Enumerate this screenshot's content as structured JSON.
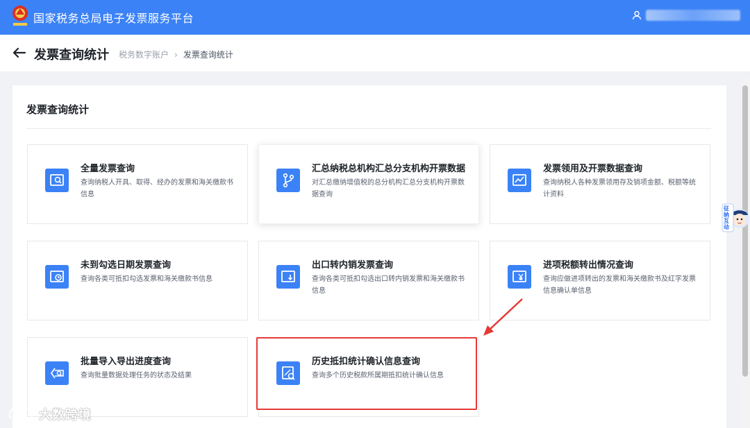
{
  "header": {
    "app_title": "国家税务总局电子发票服务平台",
    "logo_text": "国家税务",
    "brand_color": "#3b82f6"
  },
  "page": {
    "title": "发票查询统计",
    "breadcrumb": [
      "税务数字账户",
      "发票查询统计"
    ]
  },
  "section": {
    "title": "发票查询统计"
  },
  "cards": [
    {
      "title": "全量发票查询",
      "desc": "查询纳税人开具、取得、经办的发票和海关缴款书信息",
      "icon": "invoice-search-icon"
    },
    {
      "title": "汇总纳税总机构汇总分支机构开票数据",
      "desc": "对汇总缴纳增值税的总分机构汇总分支机构开票数据查询",
      "icon": "branch-icon"
    },
    {
      "title": "发票领用及开票数据查询",
      "desc": "查询纳税人各种发票领用存及销项金额、税额等统计资料",
      "icon": "trend-chart-icon"
    },
    {
      "title": "未到勾选日期发票查询",
      "desc": "查询各类可抵扣勾选发票和海关缴款书信息",
      "icon": "clock-invoice-icon"
    },
    {
      "title": "出口转内销发票查询",
      "desc": "查询各类可抵扣勾选出口转内销发票和海关缴款书信息",
      "icon": "export-invoice-icon"
    },
    {
      "title": "进项税额转出情况查询",
      "desc": "查询应做进项转出的发票和海关缴款书及红字发票信息确认单信息",
      "icon": "yen-invoice-icon"
    },
    {
      "title": "批量导入导出进度查询",
      "desc": "查询批量数据处理任务的状态及结果",
      "icon": "batch-progress-icon"
    },
    {
      "title": "历史抵扣统计确认信息查询",
      "desc": "查询多个历史税款所属期抵扣统计确认信息",
      "icon": "history-search-icon"
    }
  ],
  "highlight": {
    "color": "#e53935",
    "target_card": "历史抵扣统计确认信息查询"
  },
  "assistant": {
    "label": "征纳互动"
  },
  "watermark": {
    "text": "大数跨境"
  }
}
